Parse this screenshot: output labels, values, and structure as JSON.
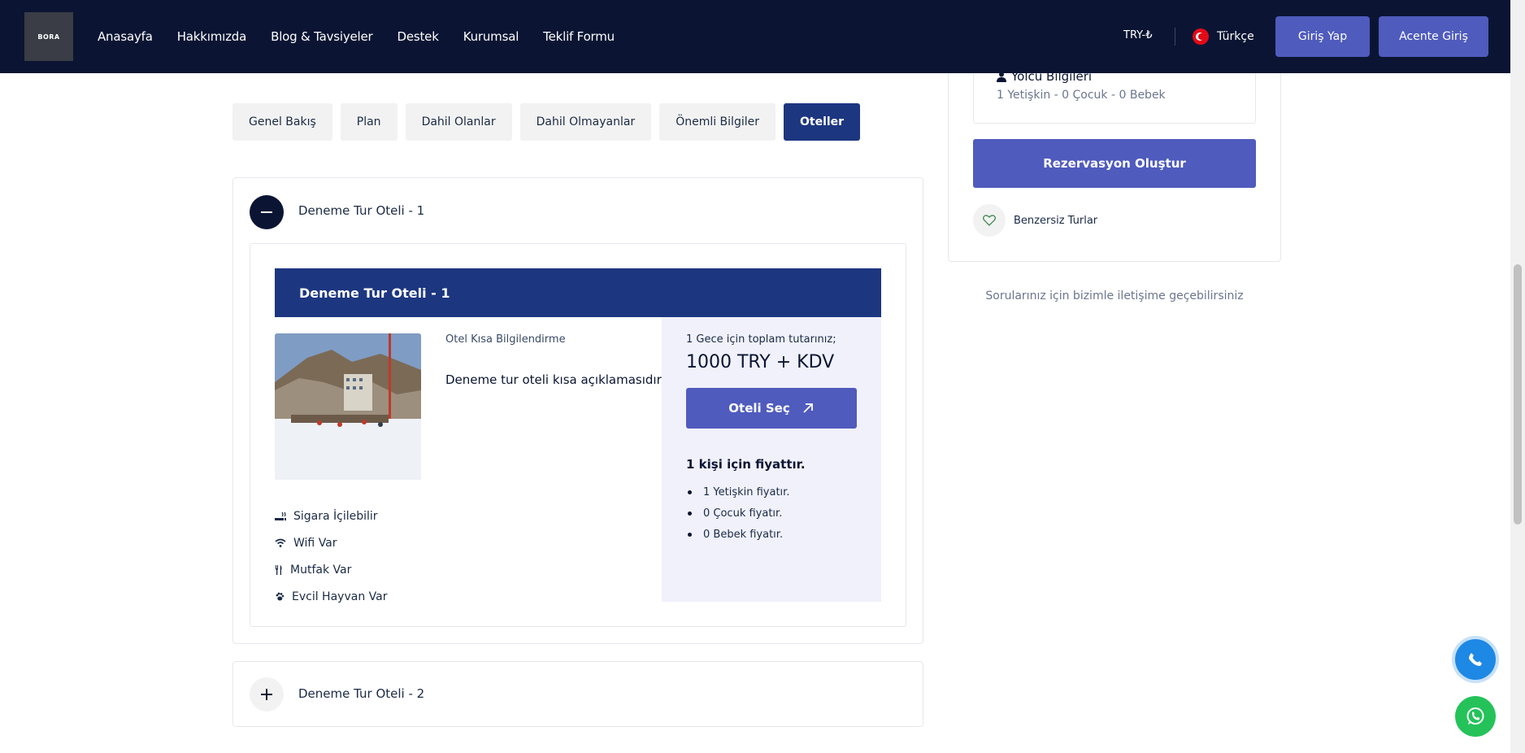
{
  "header": {
    "logo_text": "BORA",
    "nav": [
      "Anasayfa",
      "Hakkımızda",
      "Blog & Tavsiyeler",
      "Destek",
      "Kurumsal",
      "Teklif Formu"
    ],
    "currency": "TRY-₺",
    "language": "Türkçe",
    "login_label": "Giriş Yap",
    "agent_login_label": "Acente Giriş"
  },
  "tabs": [
    {
      "label": "Genel Bakış",
      "active": false
    },
    {
      "label": "Plan",
      "active": false
    },
    {
      "label": "Dahil Olanlar",
      "active": false
    },
    {
      "label": "Dahil Olmayanlar",
      "active": false
    },
    {
      "label": "Önemli Bilgiler",
      "active": false
    },
    {
      "label": "Oteller",
      "active": true
    }
  ],
  "hotels": [
    {
      "title": "Deneme Tur Oteli - 1",
      "expanded": true,
      "header": "Deneme Tur Oteli - 1",
      "info_label": "Otel Kısa Bilgilendirme",
      "info_text": "Deneme tur oteli kısa açıklamasıdır.",
      "amenities": [
        {
          "icon": "smoking-icon",
          "label": "Sigara İçilebilir"
        },
        {
          "icon": "wifi-icon",
          "label": "Wifi Var"
        },
        {
          "icon": "kitchen-icon",
          "label": "Mutfak Var"
        },
        {
          "icon": "paw-icon",
          "label": "Evcil Hayvan Var"
        }
      ],
      "price_label": "1 Gece için toplam tutarınız;",
      "price_value": "1000 TRY + KDV",
      "select_label": "Oteli Seç",
      "per_person": "1 kişi için fiyattır.",
      "price_items": [
        "1 Yetişkin fiyatır.",
        "0 Çocuk fiyatır.",
        "0 Bebek fiyatır."
      ]
    },
    {
      "title": "Deneme Tur Oteli - 2",
      "expanded": false
    }
  ],
  "sidebar": {
    "passenger_title": "Yolcu Bilgileri",
    "passenger_value": "1 Yetişkin - 0 Çocuk - 0 Bebek",
    "reserve_label": "Rezervasyon Oluştur",
    "unique_label": "Benzersiz Turlar",
    "contact_note": "Sorularınız için bizimle iletişime geçebilirsiniz"
  },
  "colors": {
    "header_bg": "#0b1533",
    "primary": "#4f5bbd",
    "accent_dark": "#1c3680",
    "price_bg": "#f0f1fb",
    "whatsapp": "#25c25a",
    "phone": "#1e88e5"
  }
}
